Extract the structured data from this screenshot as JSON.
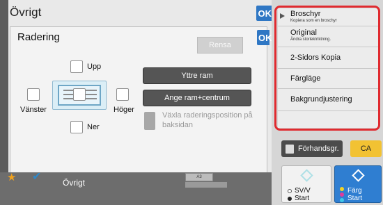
{
  "background": {
    "title": "Övrigt",
    "ok": "OK"
  },
  "dialog": {
    "title": "Radering",
    "ok": "OK",
    "rensa": "Rensa"
  },
  "erase": {
    "upp": "Upp",
    "ner": "Ner",
    "vanster": "Vänster",
    "hoger": "Höger"
  },
  "buttons": {
    "yttre_ram": "Yttre ram",
    "ange_ram_centrum": "Ange ram+centrum"
  },
  "toggle": {
    "label": "Växla raderingsposition på baksidan"
  },
  "menu": {
    "items": [
      {
        "title": "Broschyr",
        "subtitle": "Kopiera som en broschyr"
      },
      {
        "title": "Original",
        "subtitle": "Ändra storlek/riktning."
      },
      {
        "title": "2-Sidors Kopia",
        "subtitle": ""
      },
      {
        "title": "Färgläge",
        "subtitle": ""
      },
      {
        "title": "Bakgrundjustering",
        "subtitle": ""
      }
    ]
  },
  "bottom": {
    "label": "Övrigt",
    "paper": "A3"
  },
  "actions": {
    "preview": "Förhandsgr.",
    "ca": "CA",
    "svv_line1": "SV/V",
    "svv_line2": "Start",
    "farg_line1": "Färg",
    "farg_line2": "Start"
  },
  "colors": {
    "accent": "#2f77c4",
    "highlight": "#e02a2f",
    "ca": "#f2c233"
  }
}
